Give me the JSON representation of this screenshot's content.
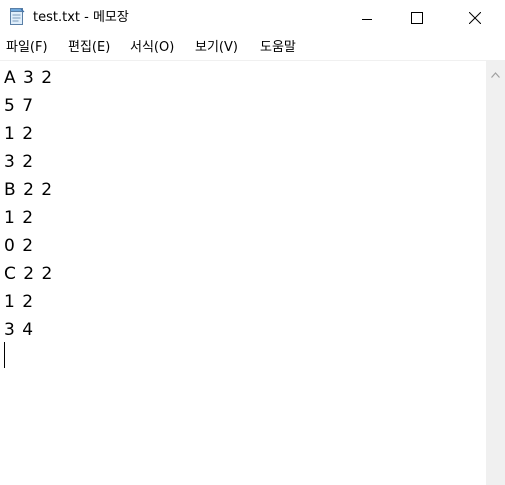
{
  "window": {
    "title": "test.txt - 메모장"
  },
  "menu": {
    "items": [
      "파일(F)",
      "편집(E)",
      "서식(O)",
      "보기(V)",
      "도움말"
    ]
  },
  "editor": {
    "lines": [
      "A 3 2",
      "5 7",
      "1 2",
      "3 2",
      "B 2 2",
      "1 2",
      "0 2",
      "C 2 2",
      "1 2",
      "3 4"
    ]
  },
  "icons": {
    "app": "notepad-icon",
    "minimize": "minimize-icon",
    "maximize": "maximize-icon",
    "close": "close-icon",
    "scroll_up": "chevron-up-icon"
  }
}
